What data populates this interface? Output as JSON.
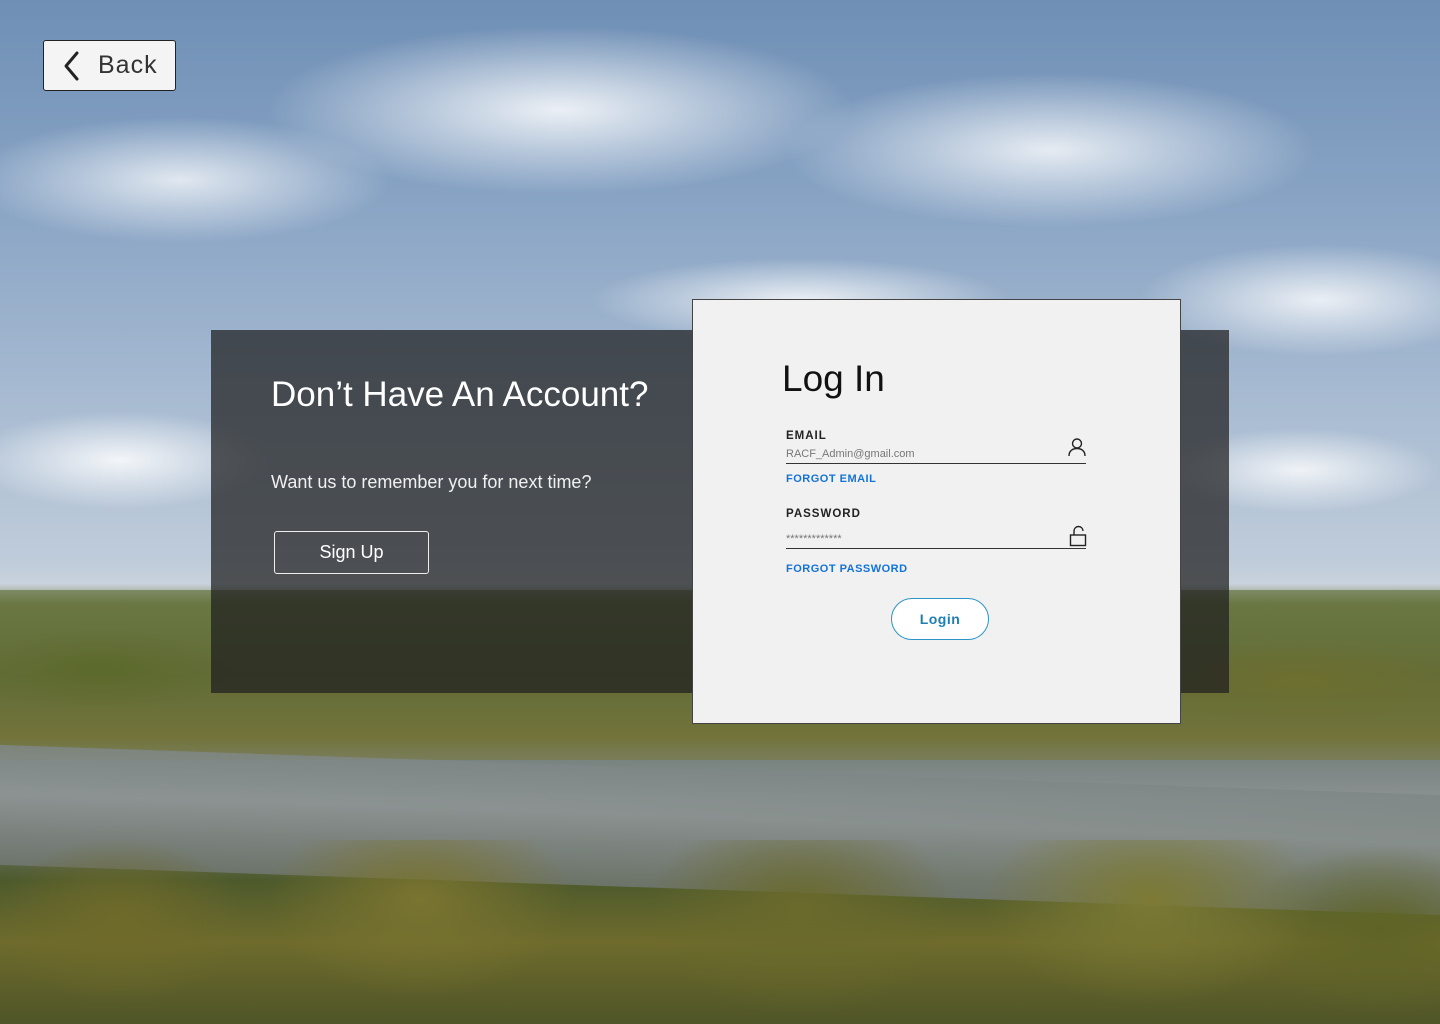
{
  "back": {
    "label": "Back",
    "icon": "chevron-left-icon"
  },
  "promo": {
    "title": "Don’t Have An Account?",
    "subtitle": "Want us to remember you for next time?",
    "signup_label": "Sign Up"
  },
  "login": {
    "title": "Log In",
    "email": {
      "label": "EMAIL",
      "value": "RACF_Admin@gmail.com",
      "icon": "user-icon",
      "forgot_label": "FORGOT EMAIL"
    },
    "password": {
      "label": "PASSWORD",
      "value": "*************",
      "icon": "unlock-icon",
      "forgot_label": "FORGOT PASSWORD"
    },
    "submit_label": "Login"
  },
  "colors": {
    "link_blue": "#1473d9",
    "login_accent": "#2b94c9",
    "panel_dark": "rgba(30,30,30,0.72)",
    "card_bg": "#f1f1f1"
  }
}
